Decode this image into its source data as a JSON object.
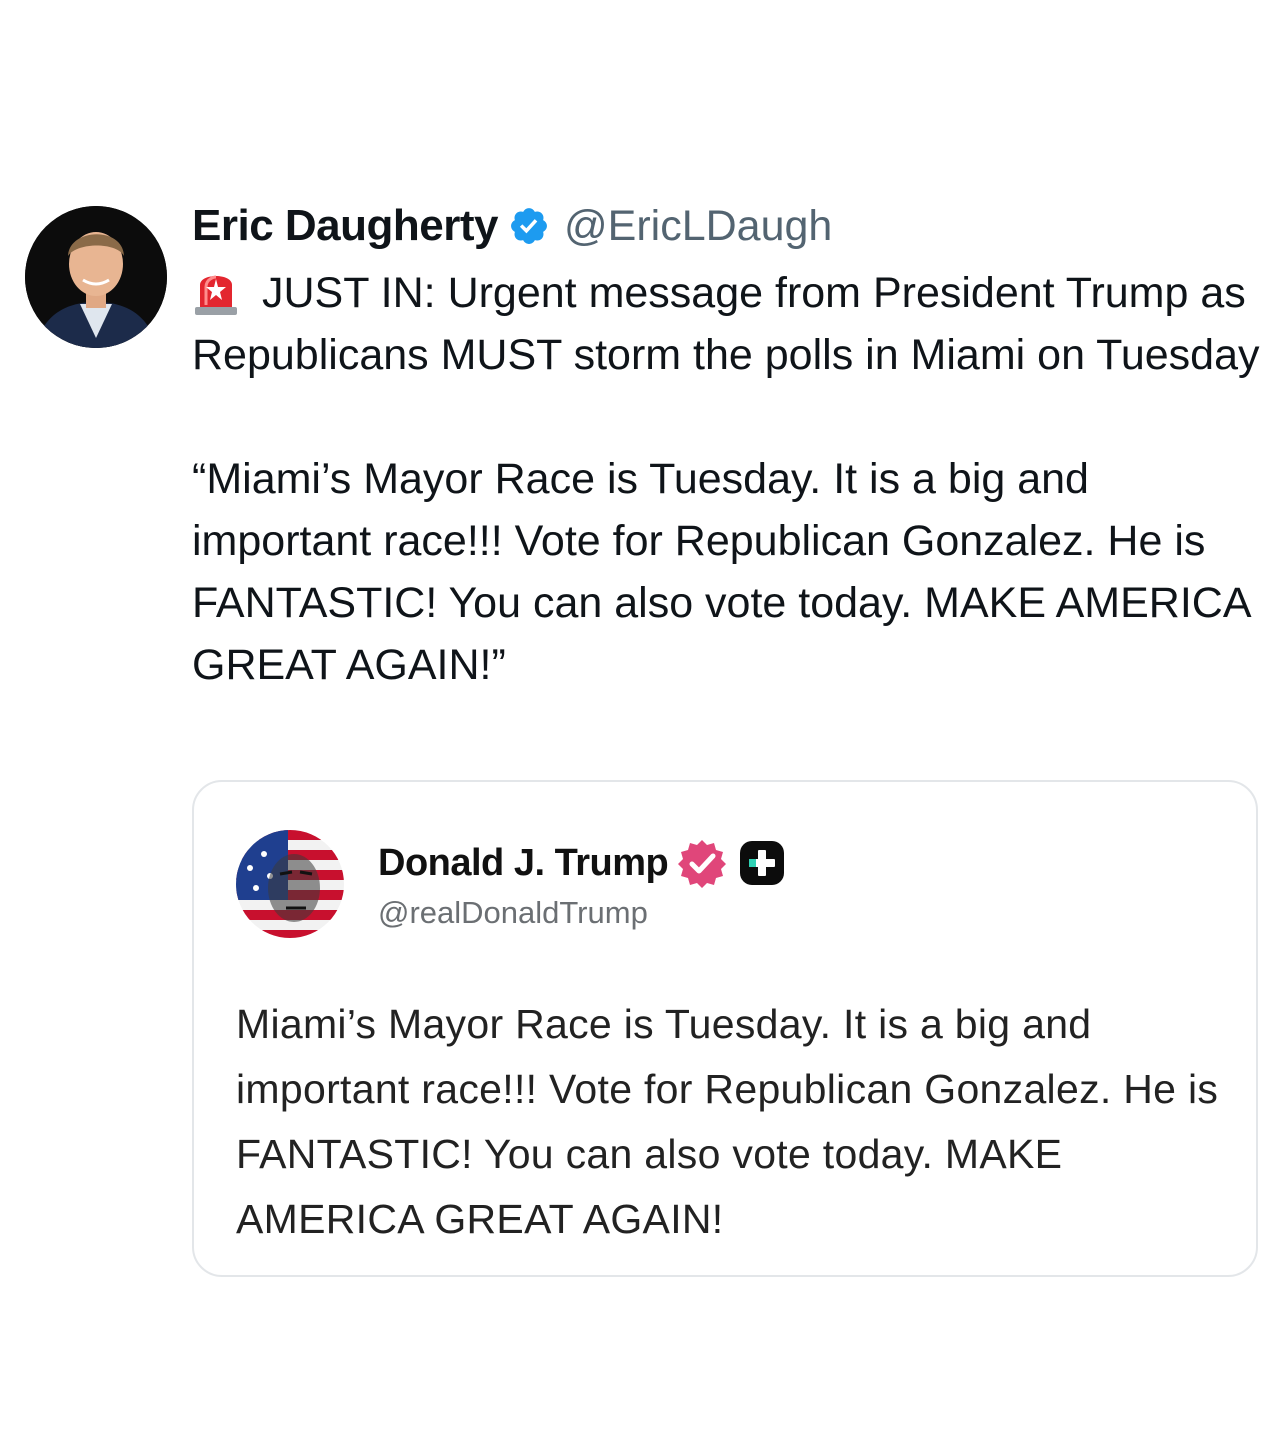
{
  "tweet": {
    "author_name": "Eric Daugherty",
    "author_handle": "@EricLDaugh",
    "verified_icon": "blue-check-icon",
    "avatar": "avatar-photo",
    "lead_icon": "police-siren-emoji",
    "text_intro": "JUST IN: Urgent message from President Trump as Republicans MUST storm the polls in Miami on Tuesday",
    "text_quote": "“Miami’s Mayor Race is Tuesday. It is a big and important race!!! Vote for Republican Gonzalez. He is FANTASTIC! You can also vote today. MAKE AMERICA GREAT AGAIN!”"
  },
  "quoted_post": {
    "author_name": "Donald J. Trump",
    "author_handle": "@realDonaldTrump",
    "badge_icon": "pink-verified-badge-icon",
    "extra_icon": "plus-square-icon",
    "avatar": "flag-portrait-avatar",
    "text": "Miami’s Mayor Race is Tuesday. It is a big and important race!!! Vote for Republican Gonzalez. He is FANTASTIC! You can also vote today. MAKE AMERICA GREAT AGAIN!"
  },
  "colors": {
    "text": "#0f1419",
    "handle": "#536471",
    "verified_blue": "#1d9bf0",
    "truth_badge": "#e0467a",
    "card_border": "#e3e6e9"
  }
}
